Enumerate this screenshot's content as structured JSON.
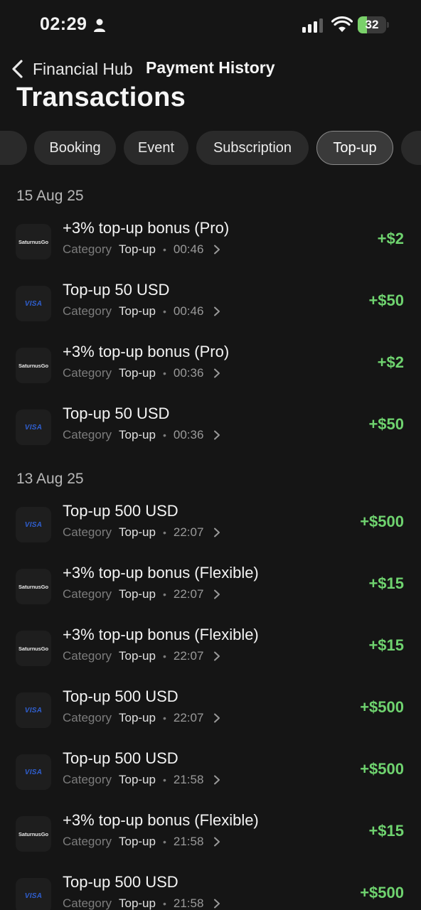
{
  "status_bar": {
    "time": "02:29",
    "battery": "32",
    "battery_level": 0.32,
    "accent_color": "#7ad16a"
  },
  "nav": {
    "back_label": "Financial Hub",
    "title": "Payment History"
  },
  "page": {
    "title": "Transactions"
  },
  "filters": {
    "chips": [
      {
        "label": ""
      },
      {
        "label": "Booking"
      },
      {
        "label": "Event"
      },
      {
        "label": "Subscription"
      },
      {
        "label": "Top-up",
        "selected": true
      },
      {
        "label": ""
      }
    ]
  },
  "colors": {
    "amount_positive": "#6fd36f",
    "background": "#151515"
  },
  "sections": [
    {
      "date": "15 Aug 25",
      "transactions": [
        {
          "logo": "SaturnusGo",
          "title": "+3% top-up bonus (Pro)",
          "category_label": "Category",
          "category": "Top-up",
          "time": "00:46",
          "amount": "+$2"
        },
        {
          "logo": "VISA",
          "title": "Top-up 50 USD",
          "category_label": "Category",
          "category": "Top-up",
          "time": "00:46",
          "amount": "+$50"
        },
        {
          "logo": "SaturnusGo",
          "title": "+3% top-up bonus (Pro)",
          "category_label": "Category",
          "category": "Top-up",
          "time": "00:36",
          "amount": "+$2"
        },
        {
          "logo": "VISA",
          "title": "Top-up 50 USD",
          "category_label": "Category",
          "category": "Top-up",
          "time": "00:36",
          "amount": "+$50"
        }
      ]
    },
    {
      "date": "13 Aug 25",
      "transactions": [
        {
          "logo": "VISA",
          "title": "Top-up 500 USD",
          "category_label": "Category",
          "category": "Top-up",
          "time": "22:07",
          "amount": "+$500"
        },
        {
          "logo": "SaturnusGo",
          "title": "+3% top-up bonus (Flexible)",
          "category_label": "Category",
          "category": "Top-up",
          "time": "22:07",
          "amount": "+$15"
        },
        {
          "logo": "SaturnusGo",
          "title": "+3% top-up bonus (Flexible)",
          "category_label": "Category",
          "category": "Top-up",
          "time": "22:07",
          "amount": "+$15"
        },
        {
          "logo": "VISA",
          "title": "Top-up 500 USD",
          "category_label": "Category",
          "category": "Top-up",
          "time": "22:07",
          "amount": "+$500"
        },
        {
          "logo": "VISA",
          "title": "Top-up 500 USD",
          "category_label": "Category",
          "category": "Top-up",
          "time": "21:58",
          "amount": "+$500"
        },
        {
          "logo": "SaturnusGo",
          "title": "+3% top-up bonus (Flexible)",
          "category_label": "Category",
          "category": "Top-up",
          "time": "21:58",
          "amount": "+$15"
        },
        {
          "logo": "VISA",
          "title": "Top-up 500 USD",
          "category_label": "Category",
          "category": "Top-up",
          "time": "21:58",
          "amount": "+$500"
        }
      ]
    }
  ]
}
